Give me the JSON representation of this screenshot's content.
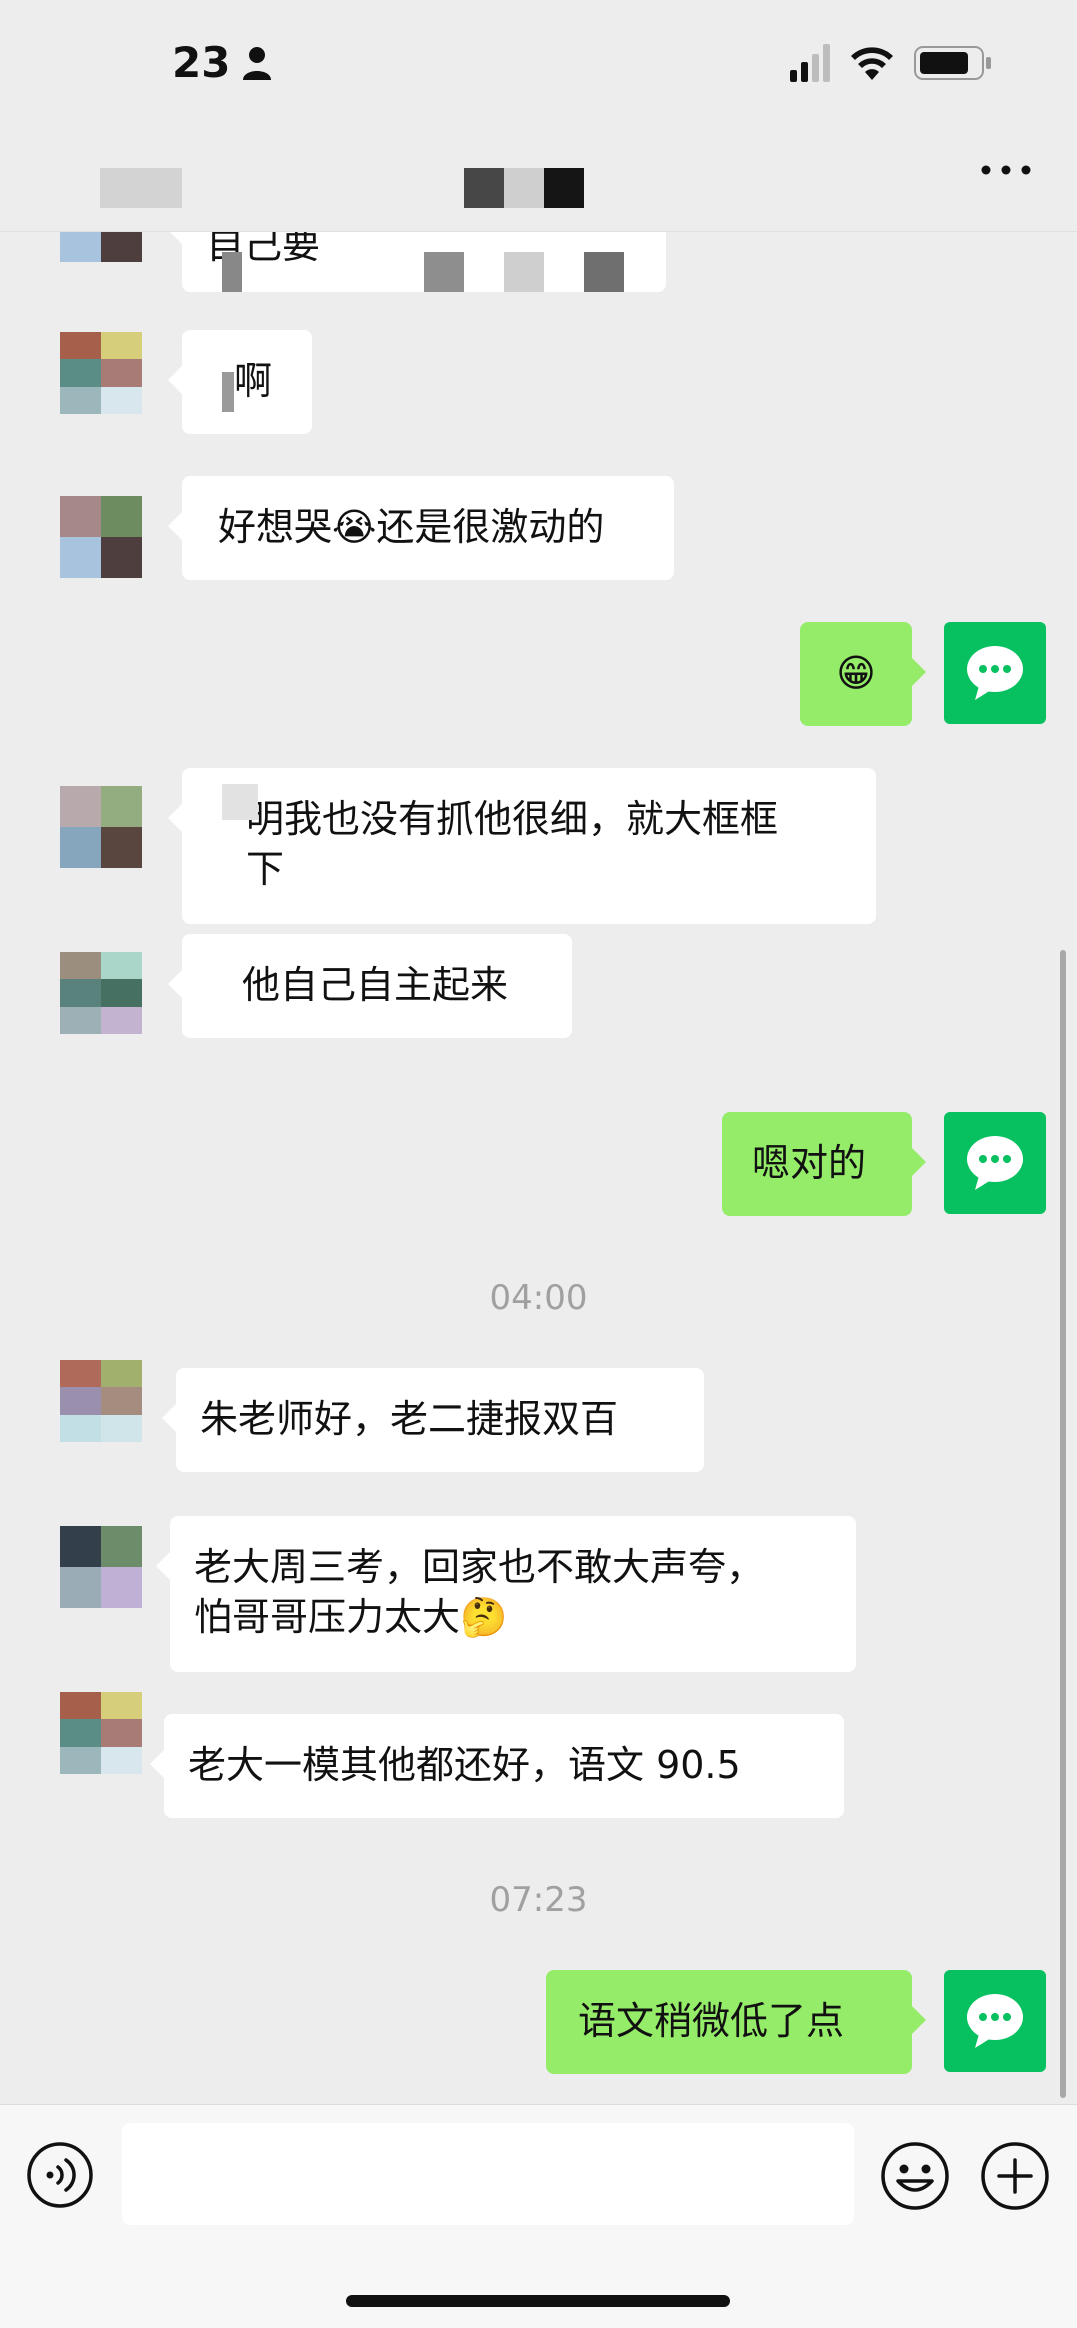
{
  "status_bar": {
    "time": "23"
  },
  "chat": {
    "messages": [
      {
        "from": "other",
        "text": "自己要"
      },
      {
        "from": "other",
        "text": "啊"
      },
      {
        "from": "other",
        "text": "好想哭😭还是很激动的"
      },
      {
        "from": "me",
        "text": "😁"
      },
      {
        "from": "other",
        "text": "明我也没有抓他很细，就大框框\n下"
      },
      {
        "from": "other",
        "text": "他自己自主起来"
      },
      {
        "from": "me",
        "text": "嗯对的"
      },
      {
        "type": "time",
        "text": "04:00"
      },
      {
        "from": "other",
        "text": "朱老师好，老二捷报双百"
      },
      {
        "from": "other",
        "text": "老大周三考，回家也不敢大声夸，\n怕哥哥压力太大🤔"
      },
      {
        "from": "other",
        "text": "老大一模其他都还好，语文 90.5"
      },
      {
        "type": "time",
        "text": "07:23"
      },
      {
        "from": "me",
        "text": "语文稍微低了点"
      }
    ]
  },
  "input": {
    "placeholder": ""
  },
  "colors": {
    "me_bubble": "#95ec69",
    "me_avatar": "#07c160",
    "background": "#ededed"
  }
}
